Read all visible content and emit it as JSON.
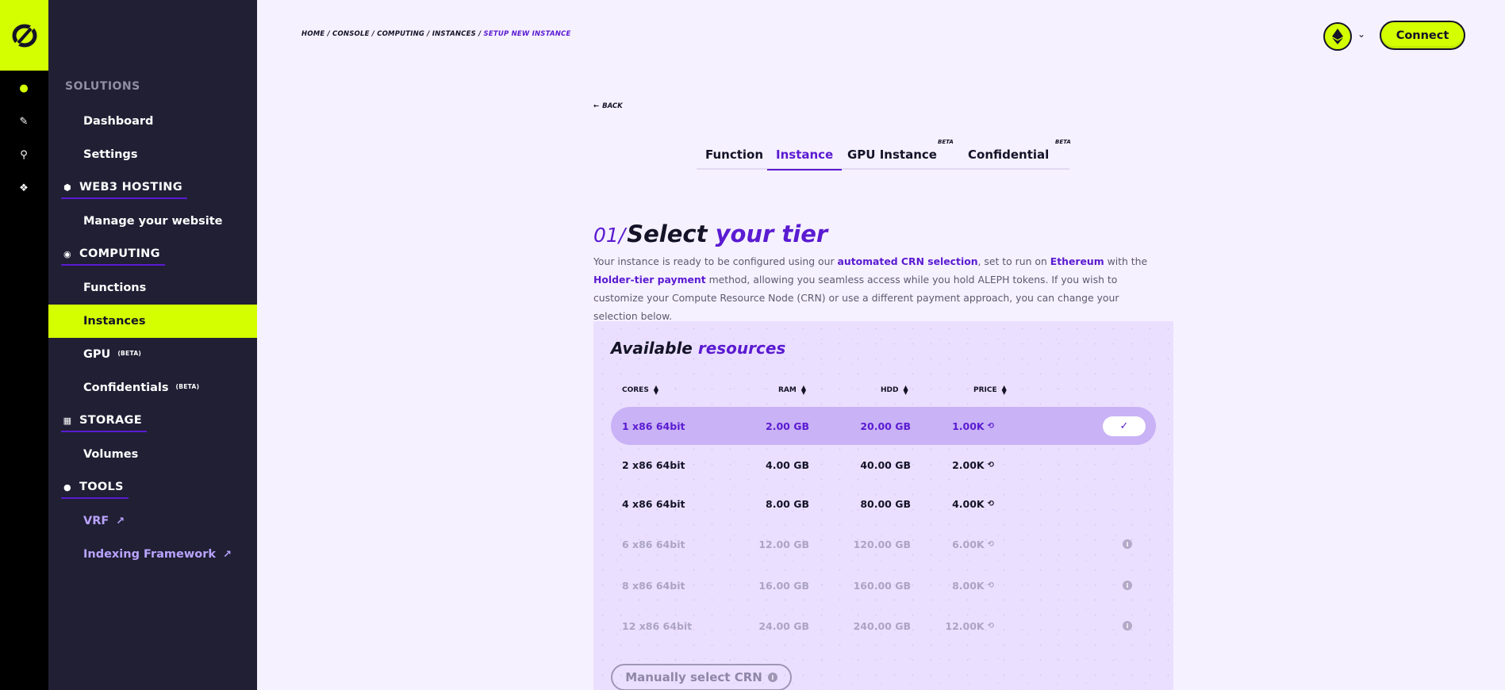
{
  "sidebar": {
    "solutions_label": "SOLUTIONS",
    "items": {
      "dashboard": "Dashboard",
      "settings": "Settings",
      "web3_hosting": "WEB3 HOSTING",
      "manage_website": "Manage your website",
      "computing": "COMPUTING",
      "functions": "Functions",
      "instances": "Instances",
      "gpu": "GPU",
      "gpu_beta": "(BETA)",
      "confidentials": "Confidentials",
      "confidentials_beta": "(BETA)",
      "storage": "STORAGE",
      "volumes": "Volumes",
      "tools": "TOOLS",
      "vrf": "VRF",
      "indexing": "Indexing Framework"
    },
    "active_item": "Instances",
    "accent_color": "#d4ff00"
  },
  "header": {
    "breadcrumb": {
      "path": "HOME / CONSOLE / COMPUTING / INSTANCES / ",
      "current": "SETUP NEW INSTANCE"
    },
    "connect_label": "Connect",
    "network_icon": "ethereum-icon"
  },
  "main": {
    "back_label": "BACK",
    "tabs": {
      "function": "Function",
      "instance": "Instance",
      "gpu_instance": "GPU Instance",
      "confidential": "Confidential",
      "beta": "BETA"
    },
    "active_tab": "Instance",
    "tier": {
      "number": "01/",
      "title_a": "Select ",
      "title_b": "your tier",
      "desc": {
        "p1": "Your instance is ready to be configured using our ",
        "b1": "automated CRN selection",
        "p2": ", set to run on ",
        "b2": "Ethereum",
        "p3": " with the ",
        "b3": "Holder-tier payment",
        "p4": " method, allowing you seamless access while you hold ALEPH tokens. If you wish to customize your Compute Resource Node (CRN) or use a different payment approach, you can change your selection below."
      }
    },
    "resources": {
      "title_a": "Available ",
      "title_b": "resources",
      "columns": {
        "cores": "CORES",
        "ram": "RAM",
        "hdd": "HDD",
        "price": "PRICE"
      },
      "rows": [
        {
          "cores": "1 x86 64bit",
          "ram": "2.00 GB",
          "hdd": "20.00 GB",
          "price": "1.00K"
        },
        {
          "cores": "2 x86 64bit",
          "ram": "4.00 GB",
          "hdd": "40.00 GB",
          "price": "2.00K"
        },
        {
          "cores": "4 x86 64bit",
          "ram": "8.00 GB",
          "hdd": "80.00 GB",
          "price": "4.00K"
        },
        {
          "cores": "6 x86 64bit",
          "ram": "12.00 GB",
          "hdd": "120.00 GB",
          "price": "6.00K"
        },
        {
          "cores": "8 x86 64bit",
          "ram": "16.00 GB",
          "hdd": "160.00 GB",
          "price": "8.00K"
        },
        {
          "cores": "12 x86 64bit",
          "ram": "24.00 GB",
          "hdd": "240.00 GB",
          "price": "12.00K"
        }
      ],
      "selected_row": "1 x86 64bit",
      "manual_label": "Manually select CRN"
    }
  },
  "colors": {
    "brand_purple": "#5a1bd1",
    "lime": "#d4ff00",
    "dark": "#141327"
  }
}
